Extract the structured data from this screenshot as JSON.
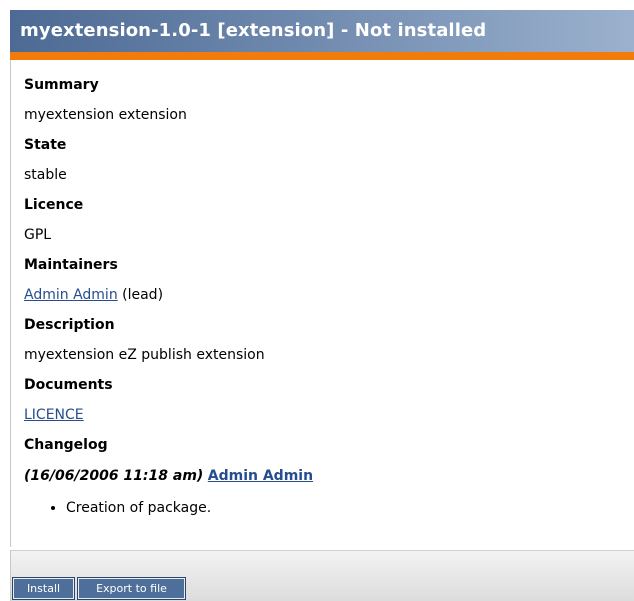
{
  "header": {
    "title": "myextension-1.0-1 [extension] - Not installed"
  },
  "fields": {
    "summary_label": "Summary",
    "summary_value": "myextension extension",
    "state_label": "State",
    "state_value": "stable",
    "licence_label": "Licence",
    "licence_value": "GPL",
    "maintainers_label": "Maintainers",
    "maintainer_name": "Admin Admin",
    "maintainer_role": "(lead)",
    "description_label": "Description",
    "description_value": "myextension eZ publish extension",
    "documents_label": "Documents",
    "document_link": "LICENCE",
    "changelog_label": "Changelog"
  },
  "changelog": {
    "date": "(16/06/2006 11:18 am)",
    "author": "Admin Admin",
    "items": [
      "Creation of package."
    ]
  },
  "buttons": {
    "install": "Install",
    "export": "Export to file"
  },
  "colors": {
    "header_start": "#4d6a94",
    "header_accent": "#f17b0b",
    "link": "#264d8f",
    "button_bg": "#4f6f9b"
  }
}
